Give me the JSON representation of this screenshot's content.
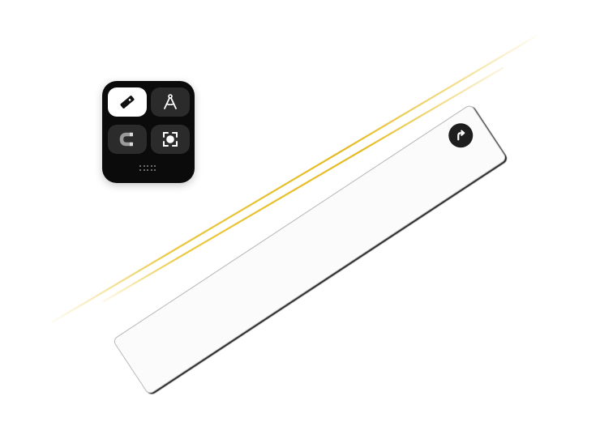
{
  "canvas": {
    "background": "#ffffff",
    "ink_color": "#e8c22a"
  },
  "palette": {
    "tools": [
      {
        "id": "ruler",
        "icon": "ruler-icon",
        "selected": true
      },
      {
        "id": "protractor",
        "icon": "compass-icon",
        "selected": false
      },
      {
        "id": "magnet",
        "icon": "magnet-icon",
        "selected": false
      },
      {
        "id": "select",
        "icon": "lasso-select-icon",
        "selected": false
      }
    ],
    "grip_icon": "drag-handle-icon",
    "background": "#0b0b0b",
    "selected_background": "#ffffff"
  },
  "ruler": {
    "rotate_icon": "rotate-arrow-icon"
  }
}
